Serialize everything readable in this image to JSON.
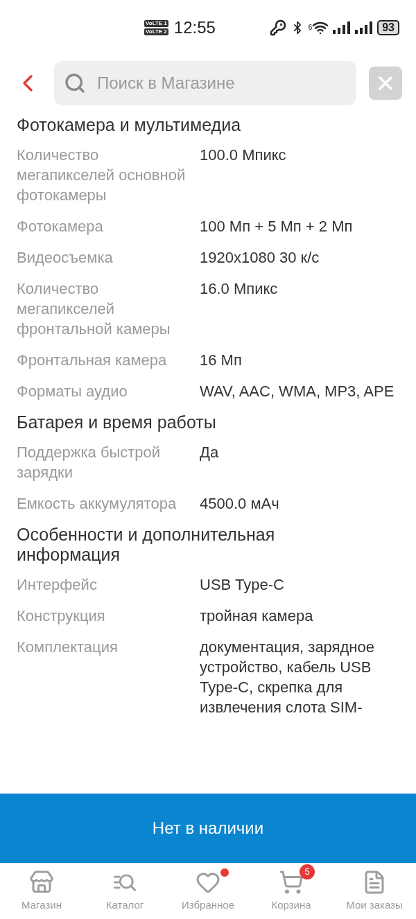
{
  "status_bar": {
    "sim_labels": [
      "VoLTE 1",
      "VoLTE 2"
    ],
    "time": "12:55",
    "wifi_badge": "6",
    "battery": "93"
  },
  "search": {
    "placeholder": "Поиск в Магазине"
  },
  "sections": [
    {
      "title": "Фотокамера и мультимедиа",
      "rows": [
        {
          "label": "Количество мегапикселей основной фотокамеры",
          "value": "100.0 Мпикс"
        },
        {
          "label": "Фотокамера",
          "value": "100 Мп + 5 Мп + 2 Мп"
        },
        {
          "label": "Видеосъемка",
          "value": "1920x1080 30 к/с"
        },
        {
          "label": "Количество мегапикселей фронтальной камеры",
          "value": "16.0 Мпикс"
        },
        {
          "label": "Фронтальная камера",
          "value": "16 Мп"
        },
        {
          "label": "Форматы аудио",
          "value": "WAV, AAC, WMA, MP3, APE"
        }
      ]
    },
    {
      "title": "Батарея и время работы",
      "rows": [
        {
          "label": "Поддержка быстрой зарядки",
          "value": "Да"
        },
        {
          "label": "Емкость аккумулятора",
          "value": "4500.0 мАч"
        }
      ]
    },
    {
      "title": "Особенности и дополнительная информация",
      "rows": [
        {
          "label": "Интерфейс",
          "value": "USB Type-C"
        },
        {
          "label": "Конструкция",
          "value": "тройная камера"
        },
        {
          "label": "Комплектация",
          "value": "документация, зарядное устройство, кабель USB Type-C, скрепка для извлечения слота SIM-"
        }
      ]
    }
  ],
  "action_button": "Нет в наличии",
  "nav": [
    {
      "kind": "store",
      "label": "Магазин",
      "dot": false
    },
    {
      "kind": "catalog",
      "label": "Каталог",
      "dot": false
    },
    {
      "kind": "favorites",
      "label": "Избранное",
      "dot": true
    },
    {
      "kind": "cart",
      "label": "Корзина",
      "dot": false,
      "badge": "5"
    },
    {
      "kind": "orders",
      "label": "Мои заказы",
      "dot": false
    }
  ]
}
